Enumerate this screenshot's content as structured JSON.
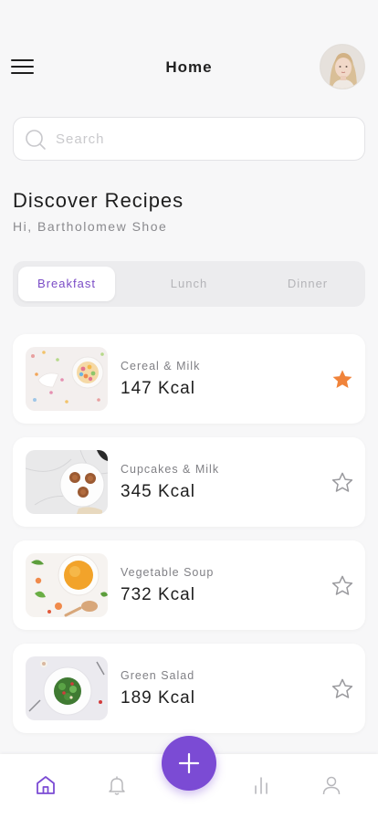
{
  "header": {
    "title": "Home",
    "menu_icon": "hamburger-menu-icon",
    "avatar_icon": "user-avatar"
  },
  "search": {
    "placeholder": "Search",
    "value": "",
    "icon": "search-icon"
  },
  "discover": {
    "title": "Discover Recipes",
    "greeting": "Hi, Bartholomew Shoe"
  },
  "tabs": [
    {
      "label": "Breakfast",
      "active": true
    },
    {
      "label": "Lunch",
      "active": false
    },
    {
      "label": "Dinner",
      "active": false
    }
  ],
  "recipes": [
    {
      "name": "Cereal & Milk",
      "kcal": "147 Kcal",
      "favorite": true,
      "image": "cereal-milk-photo"
    },
    {
      "name": "Cupcakes & Milk",
      "kcal": "345 Kcal",
      "favorite": false,
      "image": "cupcakes-photo"
    },
    {
      "name": "Vegetable Soup",
      "kcal": "732 Kcal",
      "favorite": false,
      "image": "vegetable-soup-photo"
    },
    {
      "name": "Green Salad",
      "kcal": "189 Kcal",
      "favorite": false,
      "image": "green-salad-photo"
    }
  ],
  "nav": {
    "items": [
      "home-icon",
      "bell-icon",
      "bar-chart-icon",
      "user-icon"
    ],
    "active": "home-icon",
    "fab_icon": "plus-icon"
  },
  "colors": {
    "accent": "#7b4bd4",
    "tab_active_text": "#7a4bc6",
    "star_filled": "#f0833a",
    "star_outline": "#9a9a9e",
    "background": "#f7f7f8"
  }
}
